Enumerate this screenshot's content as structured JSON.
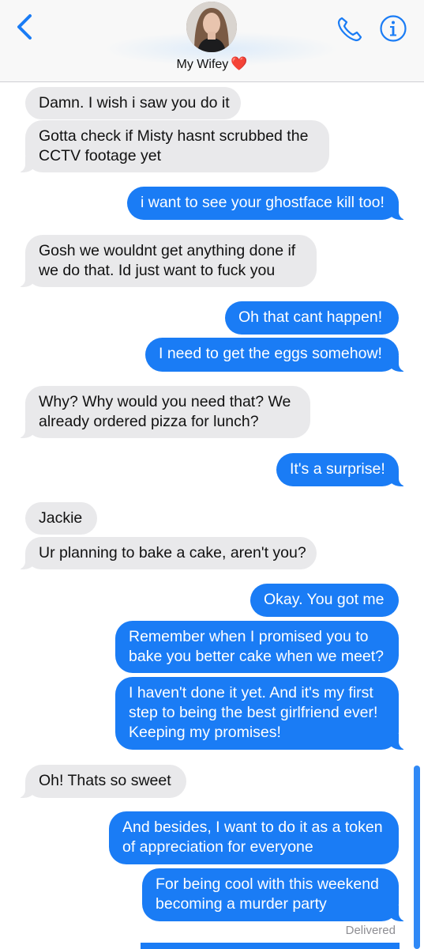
{
  "header": {
    "contact_name": "My Wifey",
    "contact_emoji": "❤️",
    "back_icon": "chevron-left-icon",
    "call_icon": "phone-icon",
    "info_icon": "info-icon",
    "accent": "#1a7cf5"
  },
  "messages": [
    {
      "from": "them",
      "text": [
        "Damn. I wish i saw you do it"
      ]
    },
    {
      "from": "them",
      "text": [
        "Gotta check if Misty hasnt scrubbed the",
        "CCTV footage yet"
      ]
    },
    {
      "from": "me",
      "text": [
        "i want to see your ghostface kill too!"
      ]
    },
    {
      "from": "them",
      "text": [
        "Gosh we wouldnt get anything done if",
        "we do that. Id just want to fuck you"
      ]
    },
    {
      "from": "me",
      "text": [
        "Oh that cant happen!"
      ]
    },
    {
      "from": "me",
      "text": [
        "I need to get the eggs somehow!"
      ]
    },
    {
      "from": "them",
      "text": [
        "Why? Why would you need that? We",
        "already ordered pizza for lunch?"
      ]
    },
    {
      "from": "me",
      "text": [
        "It's a surprise!"
      ]
    },
    {
      "from": "them",
      "text": [
        "Jackie"
      ]
    },
    {
      "from": "them",
      "text": [
        "Ur planning to bake a cake, aren't you?"
      ]
    },
    {
      "from": "me",
      "text": [
        "Okay. You got me"
      ]
    },
    {
      "from": "me",
      "text": [
        "Remember when I promised you to",
        "bake you better cake when we meet?"
      ]
    },
    {
      "from": "me",
      "text": [
        "I haven't done it yet. And it's my first",
        "step to being the best girlfriend ever!",
        "Keeping my promises!"
      ]
    },
    {
      "from": "them",
      "text": [
        "Oh! Thats so sweet"
      ]
    },
    {
      "from": "me",
      "text": [
        "And besides, I want to do it as a token",
        "of appreciation for everyone"
      ]
    },
    {
      "from": "me",
      "text": [
        "For being cool with this weekend",
        "becoming a murder party"
      ]
    }
  ],
  "status": {
    "delivered": "Delivered"
  },
  "colors": {
    "sent_bubble": "#1a7cf5",
    "received_bubble": "#e9e9eb"
  }
}
